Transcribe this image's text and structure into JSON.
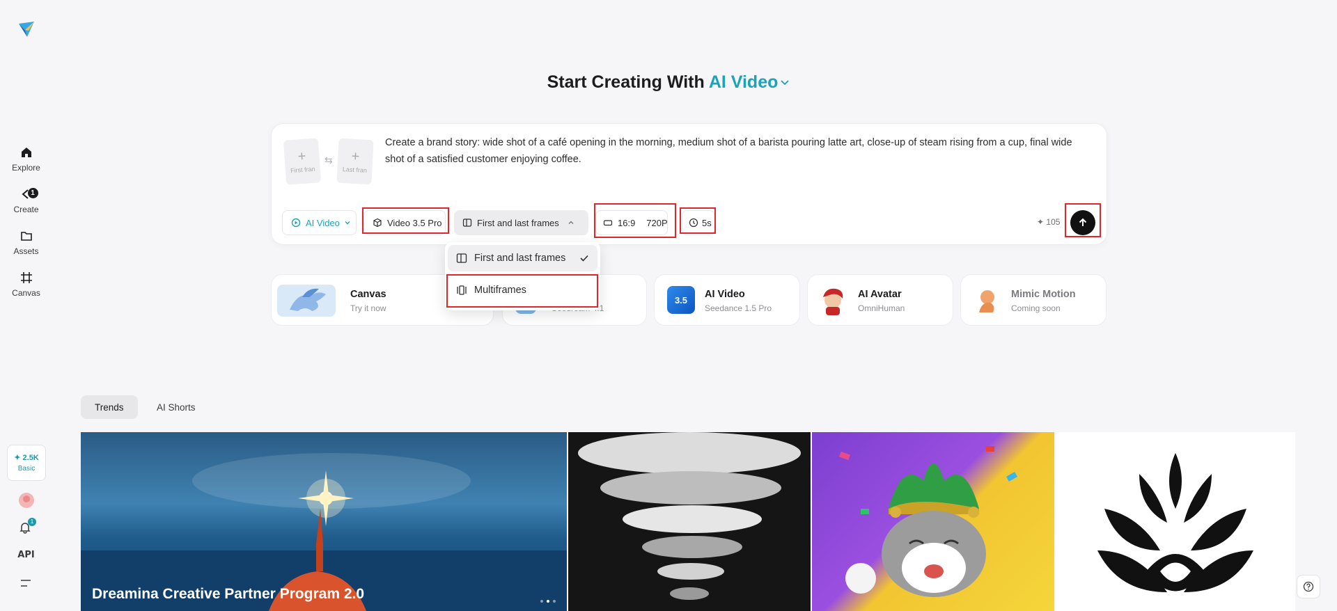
{
  "sidebar": {
    "items": [
      {
        "label": "Explore",
        "icon": "home-icon"
      },
      {
        "label": "Create",
        "icon": "create-icon",
        "badge": "1"
      },
      {
        "label": "Assets",
        "icon": "folder-icon"
      },
      {
        "label": "Canvas",
        "icon": "canvas-icon"
      }
    ],
    "credits": {
      "value": "2.5K",
      "plan": "Basic"
    },
    "notification_badge": "1",
    "api_label": "API"
  },
  "header": {
    "title_prefix": "Start Creating With",
    "title_accent": "AI Video"
  },
  "prompt": {
    "first_frame_label": "First fran",
    "last_frame_label": "Last fran",
    "text": "Create a brand story: wide shot of a café opening in the morning, medium shot of a barista pouring latte art, close-up of steam rising from a cup, final wide shot of a satisfied customer enjoying coffee."
  },
  "toolbar": {
    "mode": "AI Video",
    "model": "Video 3.5 Pro",
    "frames_mode": "First and last frames",
    "ratio": "16:9",
    "resolution": "720P",
    "duration": "5s",
    "cost": "105"
  },
  "dropdown": {
    "options": [
      {
        "label": "First and last frames",
        "selected": true
      },
      {
        "label": "Multiframes",
        "selected": false
      }
    ]
  },
  "cards": [
    {
      "title": "Canvas",
      "subtitle": "Try it now"
    },
    {
      "title": "",
      "subtitle": "Seedream 4.1"
    },
    {
      "title": "AI Video",
      "subtitle": "Seedance 1.5 Pro"
    },
    {
      "title": "AI Avatar",
      "subtitle": "OmniHuman"
    },
    {
      "title": "Mimic Motion",
      "subtitle": "Coming soon"
    }
  ],
  "tabs": [
    {
      "label": "Trends",
      "active": true
    },
    {
      "label": "AI Shorts",
      "active": false
    }
  ],
  "gallery": {
    "promo_title": "Dreamina Creative Partner Program 2.0"
  },
  "colors": {
    "accent": "#1ba3b8",
    "highlight": "#e0262d"
  }
}
